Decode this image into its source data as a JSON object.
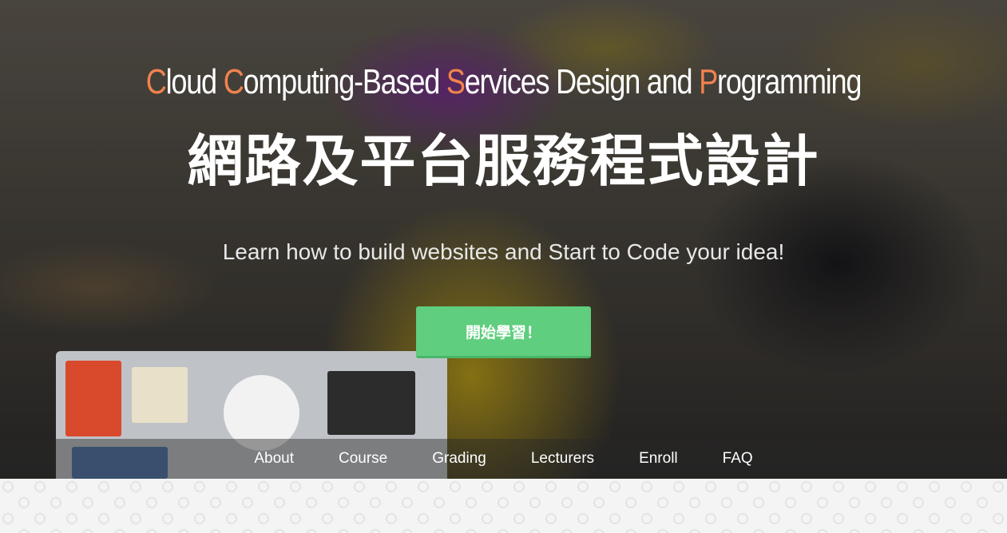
{
  "hero": {
    "subtitle_en": {
      "word1_initial": "C",
      "word1_rest": "loud ",
      "word2_initial": "C",
      "word2_rest": "omputing-Based ",
      "word3_initial": "S",
      "word3_rest": "ervices Design and ",
      "word4_initial": "P",
      "word4_rest": "rogramming"
    },
    "title_zh": "網路及平台服務程式設計",
    "tagline": "Learn how to build websites and Start to Code your idea!",
    "cta_label": "開始學習！"
  },
  "nav": {
    "items": [
      "About",
      "Course",
      "Grading",
      "Lecturers",
      "Enroll",
      "FAQ"
    ]
  },
  "colors": {
    "accent_orange": "#f0834e",
    "cta_green": "#5fce7e"
  }
}
